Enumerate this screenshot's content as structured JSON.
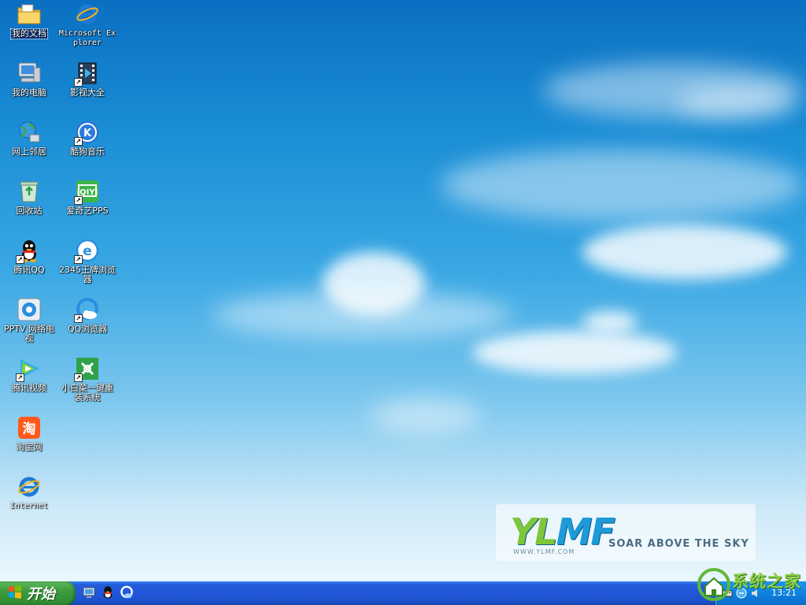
{
  "desktop": {
    "icons": [
      {
        "id": "my-documents",
        "label": "我的文档",
        "icon": "folder-documents-icon"
      },
      {
        "id": "ie-microsoft",
        "label": "Microsoft Explorer",
        "icon": "internet-explorer-icon"
      },
      {
        "id": "my-computer",
        "label": "我的电脑",
        "icon": "computer-icon"
      },
      {
        "id": "video-all",
        "label": "影视大全",
        "icon": "film-player-icon"
      },
      {
        "id": "network",
        "label": "网上邻居",
        "icon": "network-globe-icon"
      },
      {
        "id": "kugou",
        "label": "酷狗音乐",
        "icon": "kugou-music-icon"
      },
      {
        "id": "recycle",
        "label": "回收站",
        "icon": "recycle-bin-icon"
      },
      {
        "id": "iqiyi",
        "label": "爱奇艺PPS",
        "icon": "iqiyi-icon"
      },
      {
        "id": "qq",
        "label": "腾讯QQ",
        "icon": "qq-penguin-icon"
      },
      {
        "id": "browser-2345",
        "label": "2345王牌浏览器",
        "icon": "browser-2345-icon"
      },
      {
        "id": "pptv",
        "label": "PPTV 网络电视",
        "icon": "pptv-icon"
      },
      {
        "id": "qq-browser",
        "label": "QQ浏览器",
        "icon": "qq-browser-icon"
      },
      {
        "id": "tencent-video",
        "label": "腾讯视频",
        "icon": "tencent-video-icon"
      },
      {
        "id": "xiaobaicai",
        "label": "小白菜一键重装系统",
        "icon": "reinstall-tool-icon"
      },
      {
        "id": "taobao",
        "label": "淘宝网",
        "icon": "taobao-icon"
      },
      {
        "id": "internet",
        "label": "Internet",
        "icon": "internet-explorer-icon"
      }
    ]
  },
  "logo": {
    "brand_part1": "YL",
    "brand_part2": "MF",
    "slogan": "SOAR ABOVE THE SKY",
    "url": "WWW.YLMF.COM"
  },
  "taskbar": {
    "start_label": "开始",
    "quick_launch": [
      "show-desktop-icon",
      "qq-penguin-icon",
      "qq-browser-icon"
    ],
    "clock": "13:21"
  },
  "watermark": {
    "text": "系统之家"
  },
  "colors": {
    "taskbar_blue": "#245edb",
    "start_green": "#3c9c3c",
    "tray_blue": "#0f81e0",
    "logo_blue": "#1d9ad8",
    "logo_green": "#7fc638"
  }
}
